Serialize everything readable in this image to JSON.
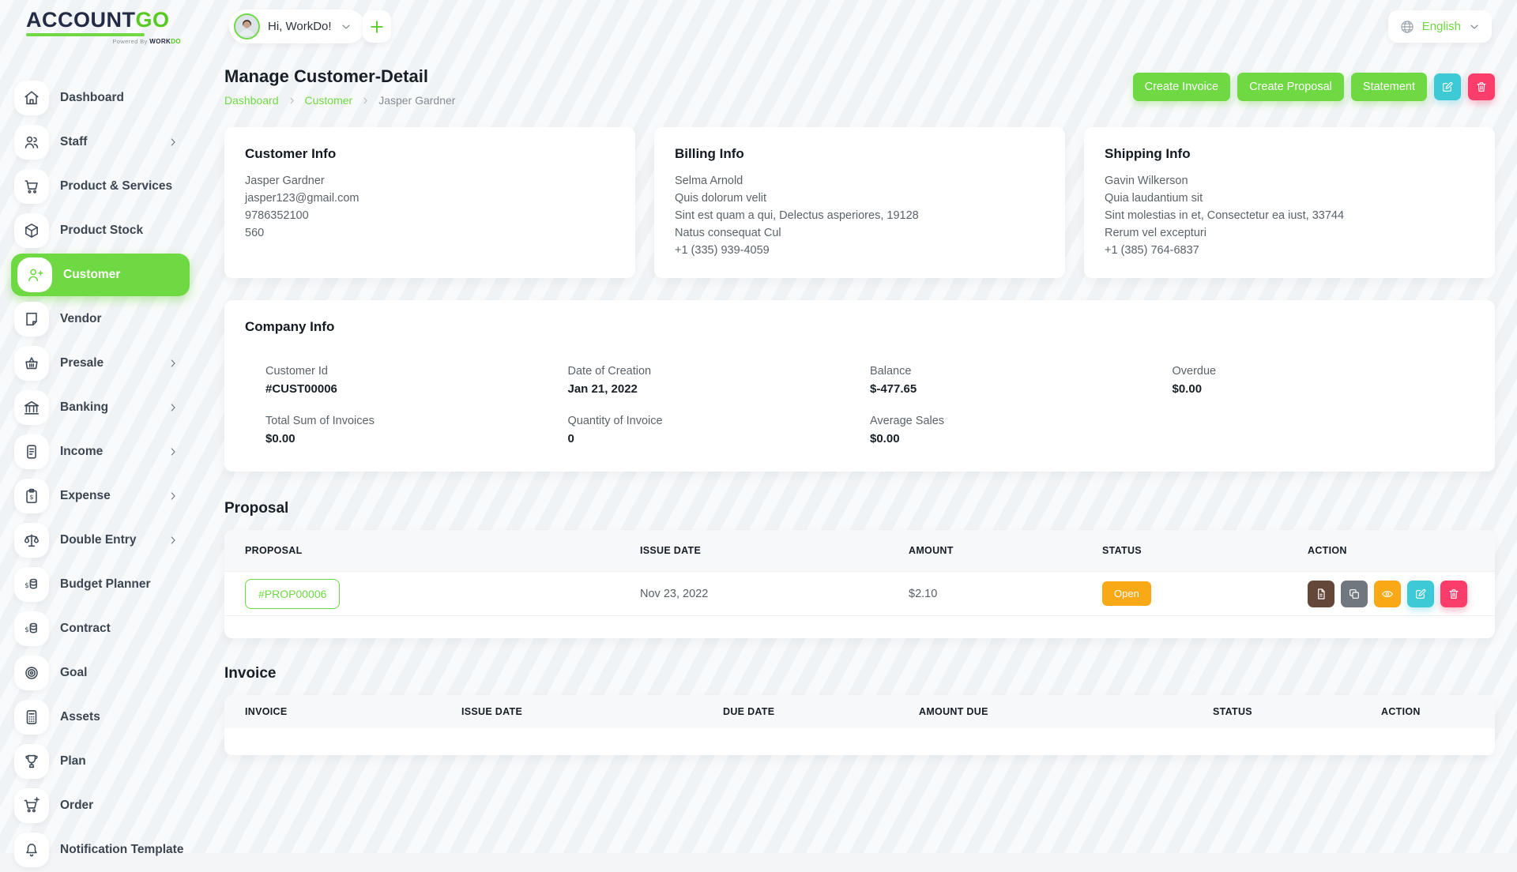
{
  "topbar": {
    "logo": {
      "part1": "ACCOUNT",
      "part2": "GO",
      "powered_prefix": "Powered By ",
      "powered_brand_dark": "WORK",
      "powered_brand_green": "DO"
    },
    "user_chip": {
      "greeting": "Hi, WorkDo!"
    },
    "language": {
      "label": "English"
    }
  },
  "sidebar": {
    "items": [
      {
        "label": "Dashboard",
        "icon": "home-icon",
        "chevron": false,
        "active": false
      },
      {
        "label": "Staff",
        "icon": "users-icon",
        "chevron": true,
        "active": false
      },
      {
        "label": "Product & Services",
        "icon": "cart-icon",
        "chevron": false,
        "active": false
      },
      {
        "label": "Product Stock",
        "icon": "cube-icon",
        "chevron": false,
        "active": false
      },
      {
        "label": "Customer",
        "icon": "user-plus-icon",
        "chevron": false,
        "active": true
      },
      {
        "label": "Vendor",
        "icon": "note-icon",
        "chevron": false,
        "active": false
      },
      {
        "label": "Presale",
        "icon": "basket-icon",
        "chevron": true,
        "active": false
      },
      {
        "label": "Banking",
        "icon": "bank-icon",
        "chevron": true,
        "active": false
      },
      {
        "label": "Income",
        "icon": "document-icon",
        "chevron": true,
        "active": false
      },
      {
        "label": "Expense",
        "icon": "clipboard-dollar-icon",
        "chevron": true,
        "active": false
      },
      {
        "label": "Double Entry",
        "icon": "scale-icon",
        "chevron": true,
        "active": false
      },
      {
        "label": "Budget Planner",
        "icon": "coins-icon",
        "chevron": false,
        "active": false
      },
      {
        "label": "Contract",
        "icon": "coins-icon",
        "chevron": false,
        "active": false
      },
      {
        "label": "Goal",
        "icon": "target-icon",
        "chevron": false,
        "active": false
      },
      {
        "label": "Assets",
        "icon": "calculator-icon",
        "chevron": false,
        "active": false
      },
      {
        "label": "Plan",
        "icon": "trophy-icon",
        "chevron": false,
        "active": false
      },
      {
        "label": "Order",
        "icon": "cart-plus-icon",
        "chevron": false,
        "active": false
      },
      {
        "label": "Notification Template",
        "icon": "bell-icon",
        "chevron": false,
        "active": false
      }
    ]
  },
  "header": {
    "title": "Manage Customer-Detail",
    "breadcrumb": [
      {
        "label": "Dashboard"
      },
      {
        "label": "Customer"
      },
      {
        "label": "Jasper Gardner"
      }
    ],
    "actions": {
      "create_invoice": "Create Invoice",
      "create_proposal": "Create Proposal",
      "statement": "Statement"
    }
  },
  "cards": {
    "customer_info": {
      "title": "Customer Info",
      "lines": [
        "Jasper Gardner",
        "jasper123@gmail.com",
        "9786352100",
        "560"
      ]
    },
    "billing_info": {
      "title": "Billing Info",
      "lines": [
        "Selma Arnold",
        "Quis dolorum velit",
        "Sint est quam a qui, Delectus asperiores, 19128",
        "Natus consequat Cul",
        "+1 (335) 939-4059"
      ]
    },
    "shipping_info": {
      "title": "Shipping Info",
      "lines": [
        "Gavin Wilkerson",
        "Quia laudantium sit",
        "Sint molestias in et, Consectetur ea iust, 33744",
        "Rerum vel excepturi",
        "+1 (385) 764-6837"
      ]
    }
  },
  "company_info": {
    "title": "Company Info",
    "fields": [
      {
        "label": "Customer Id",
        "value": "#CUST00006"
      },
      {
        "label": "Date of Creation",
        "value": "Jan 21, 2022"
      },
      {
        "label": "Balance",
        "value": "$-477.65"
      },
      {
        "label": "Overdue",
        "value": "$0.00"
      },
      {
        "label": "Total Sum of Invoices",
        "value": "$0.00"
      },
      {
        "label": "Quantity of Invoice",
        "value": "0"
      },
      {
        "label": "Average Sales",
        "value": "$0.00"
      }
    ]
  },
  "proposal": {
    "title": "Proposal",
    "columns": [
      "PROPOSAL",
      "ISSUE DATE",
      "AMOUNT",
      "STATUS",
      "ACTION"
    ],
    "rows": [
      {
        "proposal_id": "#PROP00006",
        "issue_date": "Nov 23, 2022",
        "amount": "$2.10",
        "status": "Open"
      }
    ]
  },
  "invoice": {
    "title": "Invoice",
    "columns": [
      "INVOICE",
      "ISSUE DATE",
      "DUE DATE",
      "AMOUNT DUE",
      "STATUS",
      "ACTION"
    ],
    "rows": []
  },
  "colors": {
    "accent_green": "#6fd943",
    "navy": "#232b46",
    "status_open_orange": "#f9a916",
    "info_cyan": "#3ec9d6",
    "danger_pink": "#fb3d6b",
    "action_brown": "#63483a",
    "action_gray": "#70777f"
  }
}
